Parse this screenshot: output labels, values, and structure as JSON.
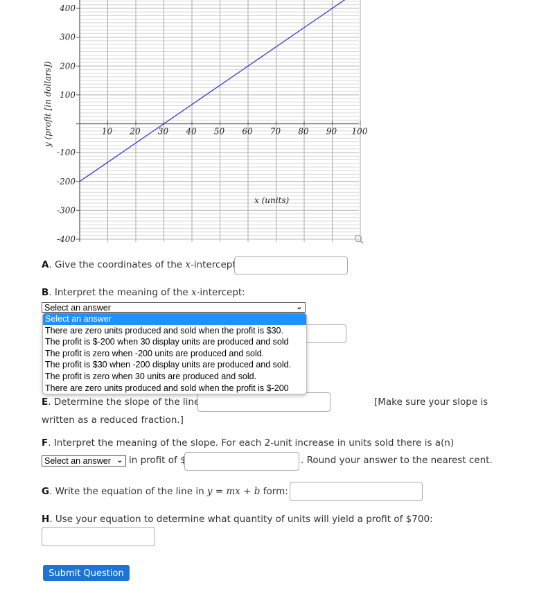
{
  "chart_data": {
    "type": "line",
    "title": "",
    "xlabel": "x (units)",
    "ylabel": "y (profit [in dollars])",
    "xlim": [
      0,
      100
    ],
    "ylim": [
      -400,
      400
    ],
    "x_ticks": [
      10,
      20,
      30,
      40,
      50,
      60,
      70,
      80,
      90,
      100
    ],
    "x_tick_labels": [
      "10",
      "20",
      "30",
      "40",
      "50",
      "60",
      "70",
      "80",
      "90",
      "100"
    ],
    "y_ticks": [
      400,
      300,
      200,
      100,
      -100,
      -200,
      -300,
      -400
    ],
    "y_tick_labels": [
      "400",
      "300",
      "200",
      "100",
      "-100",
      "-200",
      "-300",
      "-400"
    ],
    "grid": true,
    "line_color": "#3333ee",
    "series": [
      {
        "name": "profit",
        "x": [
          0,
          30,
          60,
          90,
          100
        ],
        "y": [
          -200,
          0,
          200,
          400,
          466.67
        ]
      }
    ]
  },
  "zoom_icon": "magnifier-icon",
  "questions": {
    "a": {
      "letter": "A",
      "text_before": ". Give the coordinates of the ",
      "var": "x",
      "text_after": "-intercept:",
      "value": ""
    },
    "b": {
      "letter": "B",
      "text_before": ". Interpret the meaning of the ",
      "var": "x",
      "text_after": "-intercept:",
      "selected": "Select an answer",
      "options": [
        "Select an answer",
        "There are zero units produced and sold when the profit is $30.",
        "The profit is $-200 when 30 display units are produced and sold",
        "The profit is zero when -200 units are produced and sold.",
        "The profit is $30 when -200 display units are produced and sold.",
        "The profit is zero when 30 units are produced and sold.",
        "There are zero units produced and sold when the profit is $-200"
      ]
    },
    "e": {
      "letter": "E",
      "text": ". Determine the slope of the line:",
      "note": "[Make sure your slope is",
      "note2": "written as a reduced fraction.]",
      "value": ""
    },
    "f": {
      "letter": "F",
      "text": ". Interpret the meaning of the slope. For each 2-unit increase in units sold there is a(n)",
      "selected": "Select an answer",
      "mid": "in profit of $",
      "after": ". Round your answer to the nearest cent.",
      "value": ""
    },
    "g": {
      "letter": "G",
      "text": ". Write the equation of the line in ",
      "eq_y": "y",
      "eq_eq": " = ",
      "eq_mx": "mx",
      "eq_plus": " + ",
      "eq_b": "b",
      "text_after": " form:",
      "value": ""
    },
    "h": {
      "letter": "H",
      "text": ". Use your equation to determine what quantity of units will yield a profit of $700:",
      "value": ""
    }
  },
  "submit_label": "Submit Question"
}
